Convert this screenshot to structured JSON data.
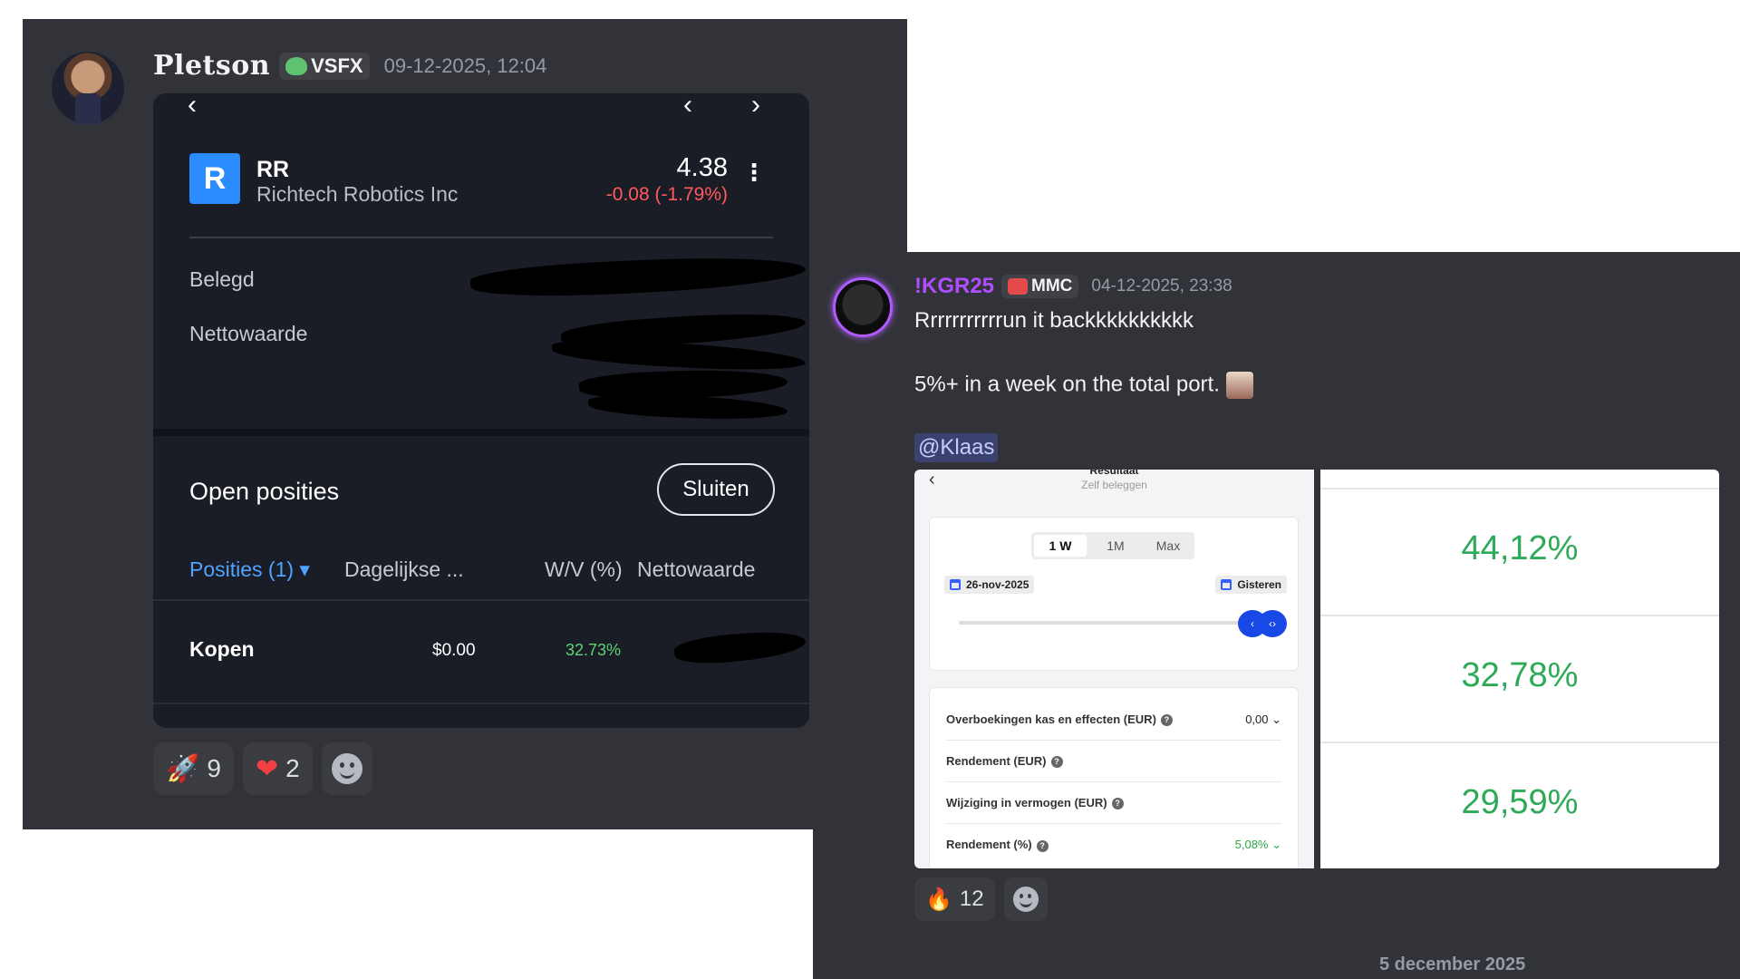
{
  "post1": {
    "username": "Pletson",
    "tag": "VSFX",
    "timestamp": "09-12-2025, 12:04",
    "embed": {
      "nav_prev": "‹",
      "nav_left": "‹",
      "nav_right": "›",
      "logo_letter": "R",
      "ticker": "RR",
      "company": "Richtech Robotics Inc",
      "price": "4.38",
      "change": "-0.08 (-1.79%)",
      "more": "⋮",
      "label_belegd": "Belegd",
      "label_netto": "Nettowaarde",
      "open_posities": "Open posities",
      "sluiten": "Sluiten",
      "col_posities": "Posities (1) ▾",
      "col_dagelijkse": "Dagelijkse ...",
      "col_wv": "W/V (%)",
      "col_netto": "Nettowaarde",
      "row_label": "Kopen",
      "row_daily": "$0.00",
      "row_wv": "32.73%"
    },
    "reactions": [
      {
        "emoji": "🚀",
        "count": "9"
      },
      {
        "emoji": "❤",
        "count": "2"
      }
    ]
  },
  "post2": {
    "username": "!KGR25",
    "tag": "MMC",
    "timestamp": "04-12-2025, 23:38",
    "line1": "Rrrrrrrrrrrun it backkkkkkkkkk",
    "line2": "5%+ in a week on the total port.",
    "mention": "@Klaas",
    "shot": {
      "title": "Resultaat",
      "subtitle": "Zelf beleggen",
      "seg": [
        "1 W",
        "1M",
        "Max"
      ],
      "date_from": "26-nov-2025",
      "date_to": "Gisteren",
      "rows": [
        {
          "label": "Overboekingen kas en effecten (EUR)",
          "value": "0,00 ⌄"
        },
        {
          "label": "Rendement (EUR)",
          "value": ""
        },
        {
          "label": "Wijziging in vermogen (EUR)",
          "value": ""
        },
        {
          "label": "Rendement (%)",
          "value": "5,08% ⌄"
        }
      ],
      "percentages": [
        "44,12%",
        "32,78%",
        "29,59%"
      ]
    },
    "reactions": [
      {
        "emoji": "🔥",
        "count": "12"
      }
    ],
    "date_divider": "5 december 2025"
  },
  "colors": {
    "discord_bg": "#313338",
    "embed_bg": "#1b1d26",
    "negative": "#ff5a5f",
    "positive": "#5bd675",
    "link_blue": "#4fa3ff",
    "username2": "#b14cff"
  }
}
